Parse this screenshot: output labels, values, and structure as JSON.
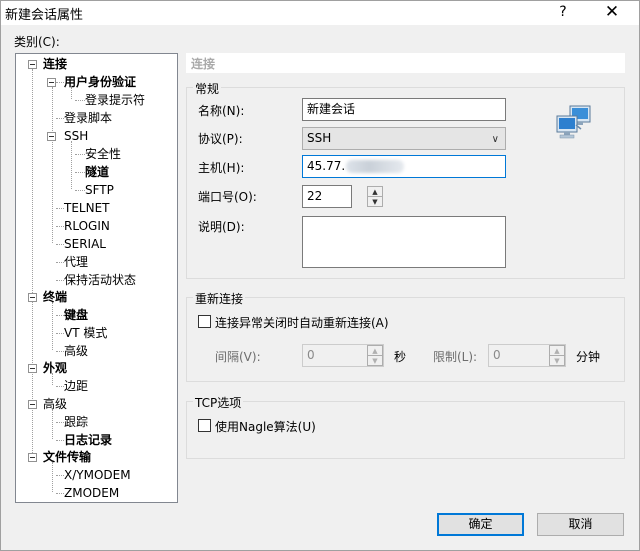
{
  "window": {
    "title": "新建会话属性",
    "help": "?",
    "close": "✕"
  },
  "category_label": "类别(C):",
  "tree": [
    {
      "label": "连接",
      "bold": true
    },
    {
      "label": "用户身份验证",
      "bold": true
    },
    {
      "label": "登录提示符",
      "bold": false
    },
    {
      "label": "登录脚本",
      "bold": false
    },
    {
      "label": "SSH",
      "bold": false
    },
    {
      "label": "安全性",
      "bold": false
    },
    {
      "label": "隧道",
      "bold": true
    },
    {
      "label": "SFTP",
      "bold": false
    },
    {
      "label": "TELNET",
      "bold": false
    },
    {
      "label": "RLOGIN",
      "bold": false
    },
    {
      "label": "SERIAL",
      "bold": false
    },
    {
      "label": "代理",
      "bold": false
    },
    {
      "label": "保持活动状态",
      "bold": false
    },
    {
      "label": "终端",
      "bold": true
    },
    {
      "label": "键盘",
      "bold": true
    },
    {
      "label": "VT 模式",
      "bold": false
    },
    {
      "label": "高级",
      "bold": false
    },
    {
      "label": "外观",
      "bold": true
    },
    {
      "label": "边距",
      "bold": false
    },
    {
      "label": "高级",
      "bold": false
    },
    {
      "label": "跟踪",
      "bold": false
    },
    {
      "label": "日志记录",
      "bold": true
    },
    {
      "label": "文件传输",
      "bold": true
    },
    {
      "label": "X/YMODEM",
      "bold": false
    },
    {
      "label": "ZMODEM",
      "bold": false
    }
  ],
  "section_title": "连接",
  "general": {
    "title": "常规",
    "name_label": "名称(N):",
    "name_value": "新建会话",
    "protocol_label": "协议(P):",
    "protocol_value": "SSH",
    "host_label": "主机(H):",
    "host_value": "45.77.",
    "port_label": "端口号(O):",
    "port_value": "22",
    "desc_label": "说明(D):",
    "desc_value": ""
  },
  "reconnect": {
    "title": "重新连接",
    "auto_label": "连接异常关闭时自动重新连接(A)",
    "interval_label": "间隔(V):",
    "interval_value": "0",
    "interval_unit": "秒",
    "limit_label": "限制(L):",
    "limit_value": "0",
    "limit_unit": "分钟"
  },
  "tcp": {
    "title": "TCP选项",
    "nagle_label": "使用Nagle算法(U)"
  },
  "buttons": {
    "ok": "确定",
    "cancel": "取消"
  },
  "colors": {
    "focus_border": "#0078d7",
    "dialog_bg": "#f0f0f0"
  }
}
